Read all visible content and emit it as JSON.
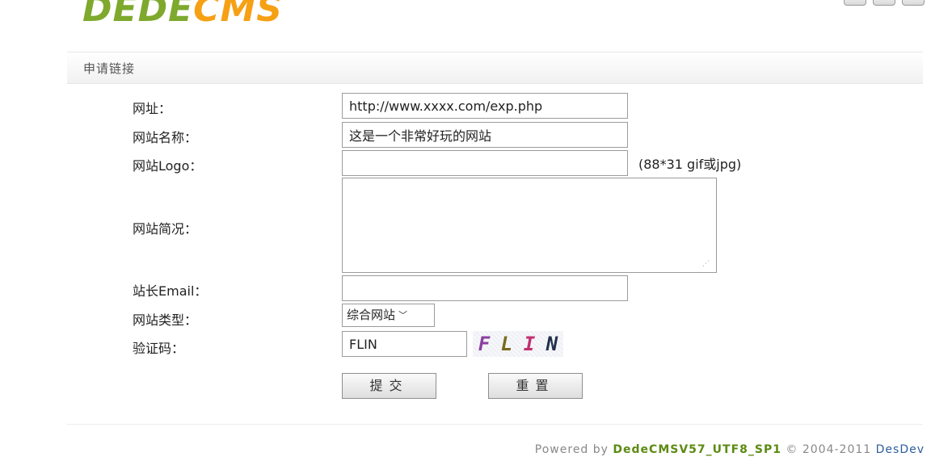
{
  "window": {
    "top_text": ""
  },
  "logo": {
    "part1": "DEDE",
    "part2": "CMS"
  },
  "section": {
    "title": "申请链接"
  },
  "form": {
    "url": {
      "label": "网址：",
      "value": "http://www.xxxx.com/exp.php"
    },
    "site_name": {
      "label": "网站名称：",
      "value": "这是一个非常好玩的网站"
    },
    "logo": {
      "label": "网站Logo：",
      "value": "",
      "hint": "(88*31 gif或jpg)"
    },
    "intro": {
      "label": "网站简况：",
      "value": ""
    },
    "email": {
      "label": "站长Email：",
      "value": ""
    },
    "type": {
      "label": "网站类型：",
      "selected": "综合网站"
    },
    "captcha": {
      "label": "验证码：",
      "value": "FLIN",
      "image_chars": [
        "F",
        "L",
        "I",
        "N"
      ]
    },
    "submit_label": "提交",
    "reset_label": "重置"
  },
  "footer": {
    "prefix": "Powered by",
    "version": "DedeCMSV57_UTF8_SP1",
    "copyright": "© 2004-2011",
    "company": "DesDev"
  },
  "colors": {
    "logo_green": "#7ea92d",
    "logo_orange": "#f6a014",
    "captcha_chars": [
      "#8a3fa0",
      "#7a6a1e",
      "#c03070",
      "#20304a"
    ]
  }
}
